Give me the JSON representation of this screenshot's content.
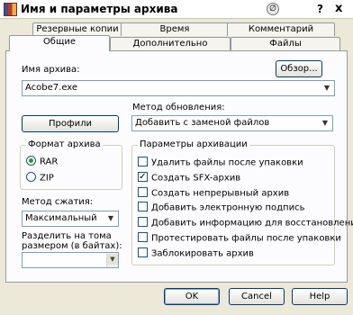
{
  "window": {
    "title": "Имя и параметры архива",
    "help": "?",
    "close": "x",
    "mark": "∅"
  },
  "tabs": {
    "back": [
      "Резервные копии",
      "Время",
      "Комментарий"
    ],
    "front": [
      "Общие",
      "Дополнительно",
      "Файлы"
    ]
  },
  "archive_name": {
    "label": "Имя архива:",
    "value": "Acobe7.exe",
    "browse": "Обзор..."
  },
  "update_method": {
    "label": "Метод обновления:",
    "value": "Добавить с заменой файлов"
  },
  "profiles_button": "Профили",
  "archive_format": {
    "title": "Формат архива",
    "options": [
      "RAR",
      "ZIP"
    ],
    "selected": "RAR"
  },
  "compression": {
    "label": "Метод сжатия:",
    "value": "Максимальный"
  },
  "split": {
    "label_line1": "Разделить на тома",
    "label_line2": "размером (в байтах):"
  },
  "archive_options": {
    "title": "Параметры архивации",
    "items": [
      {
        "label": "Удалить файлы после упаковки",
        "checked": false
      },
      {
        "label": "Создать SFX-архив",
        "checked": true
      },
      {
        "label": "Создать непрерывный архив",
        "checked": false
      },
      {
        "label": "Добавить электронную подпись",
        "checked": false
      },
      {
        "label": "Добавить информацию для восстановления",
        "checked": false
      },
      {
        "label": "Протестировать файлы после упаковки",
        "checked": false
      },
      {
        "label": "Заблокировать архив",
        "checked": false
      }
    ]
  },
  "buttons": {
    "ok": "OK",
    "cancel": "Cancel",
    "help": "Help"
  },
  "icons": {
    "dropdown": "▼",
    "scroll_up": "▲",
    "scroll_down": "▼",
    "check": "✓"
  }
}
